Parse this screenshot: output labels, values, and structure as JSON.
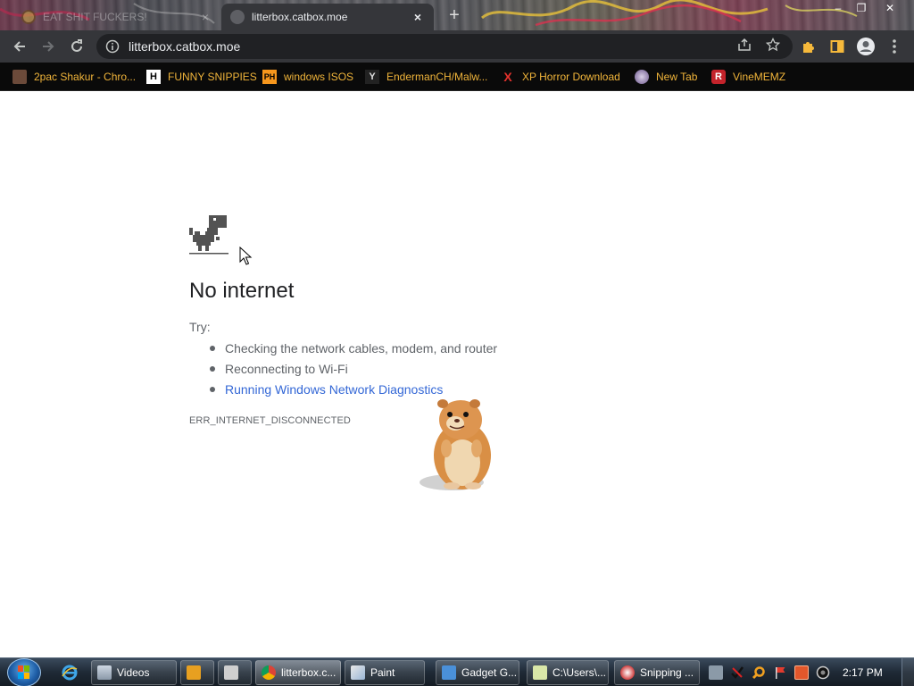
{
  "tabs": [
    {
      "title": "EAT SHIT FUCKERS!",
      "close": "×",
      "active": false
    },
    {
      "title": "litterbox.catbox.moe",
      "close": "×",
      "active": true
    }
  ],
  "new_tab_symbol": "+",
  "window_controls": {
    "minimize": "–",
    "maximize": "❐",
    "close": "✕"
  },
  "toolbar": {
    "url": "litterbox.catbox.moe"
  },
  "bookmarks": [
    {
      "label": "2pac Shakur - Chro...",
      "icon": "2pac-icon"
    },
    {
      "label": "FUNNY SNIPPIES",
      "icon": "H"
    },
    {
      "label": "windows ISOS",
      "icon": "PH"
    },
    {
      "label": "EndermanCH/Malw...",
      "icon": "Y"
    },
    {
      "label": "XP Horror Download",
      "icon": "X"
    },
    {
      "label": "New Tab",
      "icon": "globe-icon"
    },
    {
      "label": "VineMEMZ",
      "icon": "R"
    }
  ],
  "error_page": {
    "heading": "No internet",
    "try_label": "Try:",
    "suggestions": [
      "Checking the network cables, modem, and router",
      "Reconnecting to Wi-Fi",
      "Running Windows Network Diagnostics"
    ],
    "error_code": "ERR_INTERNET_DISCONNECTED"
  },
  "taskbar": {
    "items": [
      {
        "label": "Videos"
      },
      {
        "label": "litterbox.c..."
      },
      {
        "label": "Paint"
      },
      {
        "label": "Gadget G..."
      },
      {
        "label": "C:\\Users\\..."
      },
      {
        "label": "Snipping ..."
      }
    ],
    "clock": "2:17 PM"
  },
  "colors": {
    "link": "#3367d6",
    "bookmark_text": "#f0b43a",
    "toolbar_bg": "#35363a"
  }
}
